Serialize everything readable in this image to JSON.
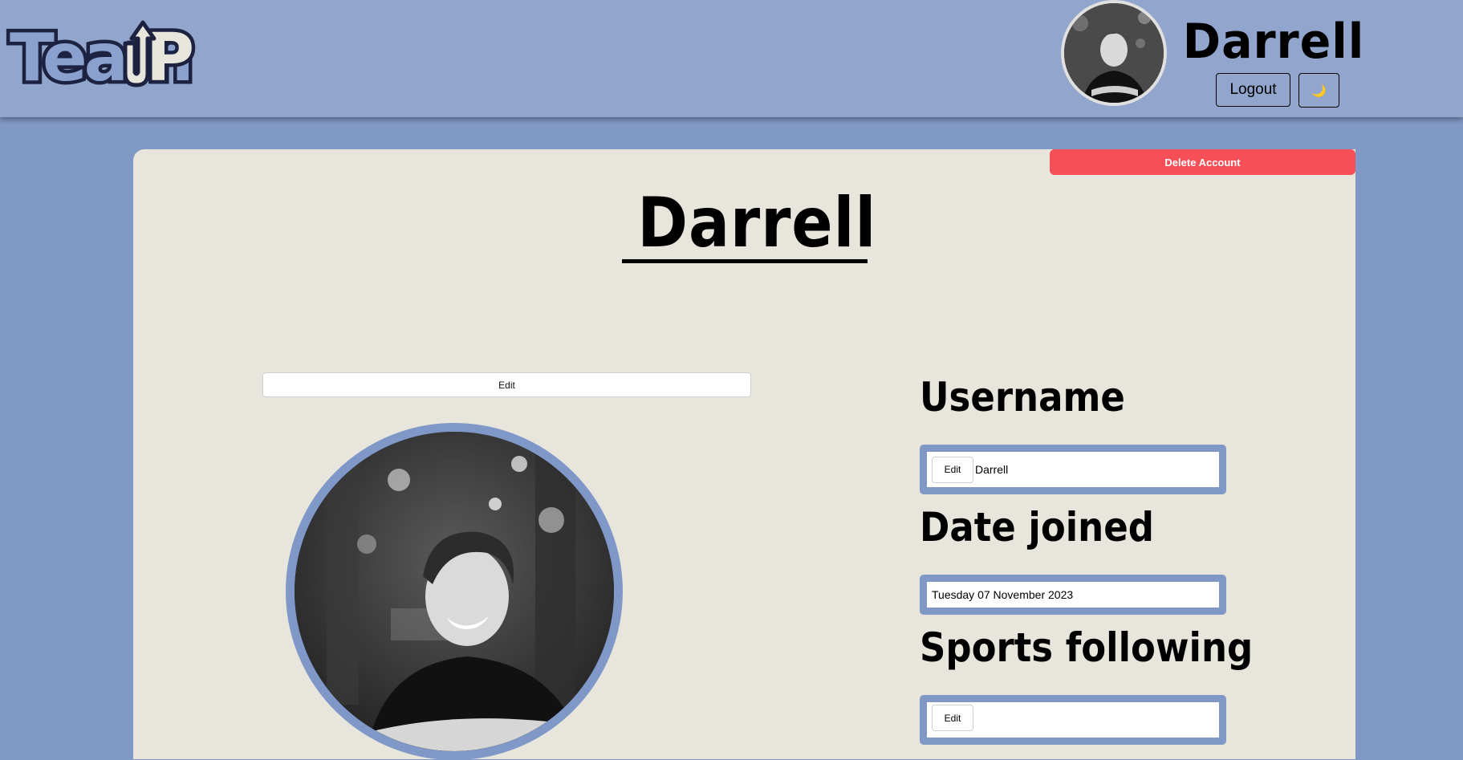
{
  "header": {
    "logo_text": "TeamUP",
    "username": "Darrell",
    "logout_label": "Logout",
    "theme_toggle_icon": "🌙"
  },
  "profile": {
    "delete_account_label": "Delete Account",
    "title": "Darrell",
    "avatar_edit_label": "Edit",
    "sections": {
      "username": {
        "label": "Username",
        "edit_label": "Edit",
        "value": "Darrell"
      },
      "date_joined": {
        "label": "Date joined",
        "value": "Tuesday 07 November 2023"
      },
      "sports_following": {
        "label": "Sports following",
        "edit_label": "Edit"
      }
    }
  },
  "colors": {
    "page_bg": "#8098c6",
    "header_bg": "#91a5cd",
    "card_bg": "#e8e6dc",
    "danger": "#f55058",
    "field_frame": "#8098c6"
  }
}
